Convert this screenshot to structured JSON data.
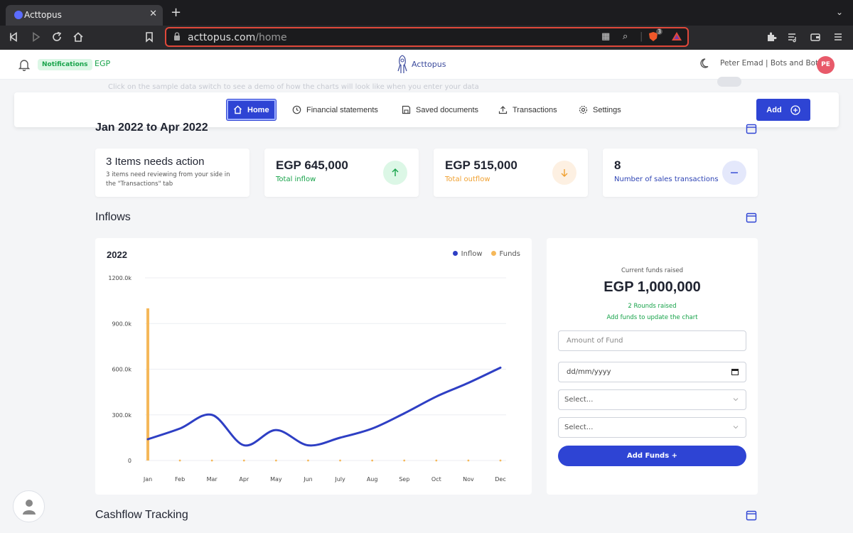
{
  "browser": {
    "tab_title": "Acttopus",
    "url_domain": "acttopus.com",
    "url_path": "/home",
    "extension_badge": "3"
  },
  "header": {
    "notifications_label": "Notifications",
    "currency": "EGP",
    "logo_text": "Acttopus",
    "user_label": "Peter Emad | Bots and Bots",
    "avatar_initials": "PE"
  },
  "sample_note": "Click on the sample data switch to see a demo of how the charts will look like when you enter your data",
  "nav": {
    "items": [
      {
        "label": "Home",
        "icon": "home-icon",
        "active": true
      },
      {
        "label": "Financial statements",
        "icon": "clock-icon",
        "active": false
      },
      {
        "label": "Saved documents",
        "icon": "save-icon",
        "active": false
      },
      {
        "label": "Transactions",
        "icon": "upload-icon",
        "active": false
      },
      {
        "label": "Settings",
        "icon": "gear-icon",
        "active": false
      }
    ],
    "add_label": "Add"
  },
  "date_range": "Jan 2022 to Apr 2022",
  "cards": {
    "action": {
      "title": "3 Items needs action",
      "desc": "3 items need reviewing from your side in the \"Transactions\" tab"
    },
    "inflow": {
      "value": "EGP 645,000",
      "label": "Total inflow"
    },
    "outflow": {
      "value": "EGP 515,000",
      "label": "Total outflow"
    },
    "sales": {
      "value": "8",
      "label": "Number of sales transactions"
    }
  },
  "sections": {
    "inflows": "Inflows",
    "cashflow": "Cashflow Tracking"
  },
  "funds": {
    "current_label": "Current funds raised",
    "amount": "EGP 1,000,000",
    "rounds": "2 Rounds raised",
    "hint": "Add funds to update the chart",
    "amount_placeholder": "Amount of Fund",
    "date_placeholder": "dd/mm/yyyy",
    "select1": "Select...",
    "select2": "Select...",
    "button": "Add Funds +"
  },
  "colors": {
    "primary": "#2e44d4",
    "green": "#17a34a",
    "orange": "#f0a030",
    "inflow_line": "#2e3fc4",
    "funds_bar": "#f5b85a"
  },
  "chart_data": {
    "type": "line",
    "title": "2022",
    "xlabel": "",
    "ylabel": "",
    "categories": [
      "Jan",
      "Feb",
      "Mar",
      "Apr",
      "May",
      "Jun",
      "July",
      "Aug",
      "Sep",
      "Oct",
      "Nov",
      "Dec"
    ],
    "y_tick_labels": [
      "0",
      "300.0k",
      "600.0k",
      "900.0k",
      "1200.0k"
    ],
    "y_ticks": [
      0,
      300000,
      600000,
      900000,
      1200000
    ],
    "ylim": [
      0,
      1200000
    ],
    "legend_position": "top-right",
    "grid": true,
    "series": [
      {
        "name": "Inflow",
        "type": "line",
        "color": "#2e3fc4",
        "values": [
          140000,
          210000,
          300000,
          100000,
          200000,
          100000,
          150000,
          210000,
          310000,
          420000,
          510000,
          610000
        ]
      },
      {
        "name": "Funds",
        "type": "bar",
        "color": "#f5b85a",
        "values": [
          1000000,
          0,
          0,
          0,
          0,
          0,
          0,
          0,
          0,
          0,
          0,
          0
        ]
      }
    ]
  }
}
